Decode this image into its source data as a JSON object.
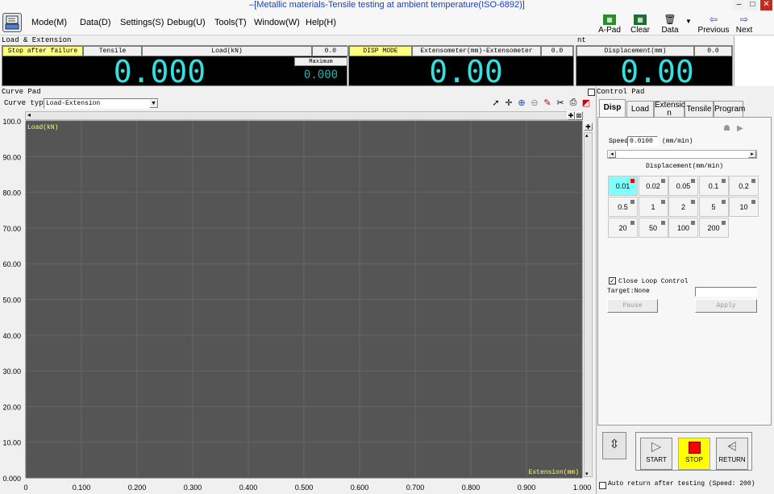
{
  "window": {
    "title": "–[Metallic materials-Tensile testing at ambient temperature(ISO-6892)]",
    "min": "–",
    "max": "□",
    "close": "✕"
  },
  "menu": [
    {
      "label": "Mode(M)"
    },
    {
      "label": "Data(D)"
    },
    {
      "label": "Settings(S)"
    },
    {
      "label": "Debug(U)"
    },
    {
      "label": "Tools(T)"
    },
    {
      "label": "Window(W)"
    },
    {
      "label": "Help(H)"
    }
  ],
  "toolbar": {
    "apad": "A-Pad",
    "clear": "Clear",
    "data": "Data",
    "previous": "Previous",
    "next": "Next"
  },
  "load_extension": {
    "section_title": "Load & Extension",
    "stop_after_failure": "Stop after failure",
    "tensile": "Tensile",
    "load_header": "Load(kN)",
    "load_small": "0.0",
    "load_value": "0.000",
    "maximum_label": "Maximum",
    "maximum_value": "0.000",
    "disp_mode": "DISP MODE",
    "ext_header": "Extensometer(mm)-Extensometer",
    "ext_small": "0.0",
    "ext_value": "0.00",
    "section_title_right": "nt",
    "disp_header": "Displacement(mm)",
    "disp_small": "0.0",
    "disp_value": "0.00"
  },
  "curve": {
    "title": "Curve Pad",
    "type_label": "Curve type:",
    "type_value": "Load-Extension",
    "ylabel": "Load(kN)",
    "xlabel": "Extension(mm)"
  },
  "chart_data": {
    "type": "line",
    "series": [],
    "xlabel": "Extension(mm)",
    "ylabel": "Load(kN)",
    "xlim": [
      0,
      1.0
    ],
    "ylim": [
      0,
      100
    ],
    "xticks": [
      "0",
      "0.100",
      "0.200",
      "0.300",
      "0.400",
      "0.500",
      "0.600",
      "0.700",
      "0.800",
      "0.900",
      "1.000"
    ],
    "yticks": [
      "100.0",
      "90.00",
      "80.00",
      "70.00",
      "60.00",
      "50.00",
      "40.00",
      "30.00",
      "20.00",
      "10.00",
      "0.000"
    ],
    "grid": true
  },
  "control": {
    "title": "Control Pad",
    "tabs": [
      {
        "label": "Disp"
      },
      {
        "label": "Load"
      },
      {
        "label": "Extensio\nn"
      },
      {
        "label": "Tensile"
      },
      {
        "label": "Program"
      }
    ],
    "speed_label": "Speed",
    "speed_value": "0.0100",
    "speed_unit": "(mm/min)",
    "displacement_title": "Displacement(mm/min)",
    "buttons": [
      "0.01",
      "0.02",
      "0.05",
      "0.1",
      "0.2",
      "0.5",
      "1",
      "2",
      "5",
      "10",
      "20",
      "50",
      "100",
      "200"
    ],
    "close_loop": "Close Loop Control",
    "target": "Target:None",
    "pause": "Pause",
    "apply": "Apply",
    "start": "START",
    "stop": "STOP",
    "return": "RETURN",
    "auto_return": "Auto return after testing (Speed: 200)"
  },
  "colors": {
    "accent": "#33e0e0",
    "plot_bg": "#555555",
    "stop": "#ffff00",
    "label": "#ffff66"
  }
}
